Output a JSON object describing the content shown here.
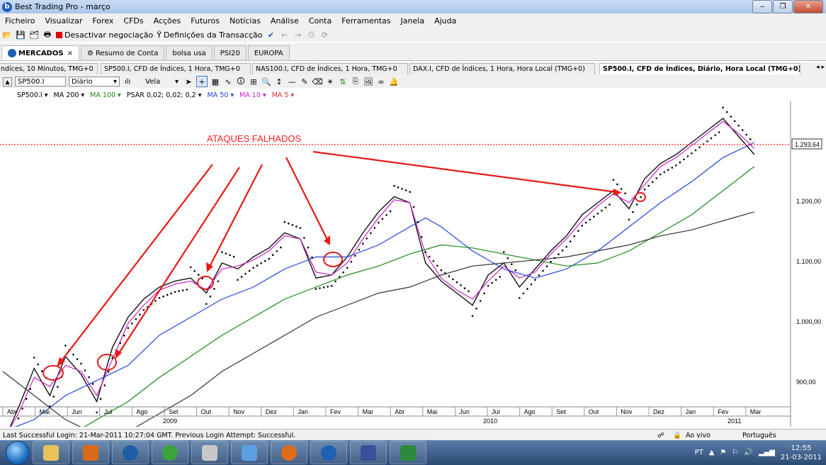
{
  "window": {
    "title": "Best Trading Pro - março",
    "minimize": "‒",
    "maximize": "❐",
    "close": "✕"
  },
  "menu": [
    "Ficheiro",
    "Visualizar",
    "Forex",
    "CFDs",
    "Acções",
    "Futuros",
    "Notícias",
    "Análise",
    "Conta",
    "Ferramentas",
    "Janela",
    "Ajuda"
  ],
  "toolbar": {
    "deactivate": "Desactivar negociação",
    "settings": "Definições da Transacção"
  },
  "workspace_tabs": [
    "MERCADOS",
    "Resumo de Conta",
    "bolsa usa",
    "PSI20",
    "EUROPA"
  ],
  "workspace_close": "×",
  "chart_tabs": [
    "ndices, 10 Minutos, TMG+0",
    "SP500.I, CFD de Índices, 1 Hora, TMG+0",
    "NAS100.I, CFD de Índices, 1 Hora, TMG+0",
    "DAX.I, CFD de Índices, 1 Hora, Hora Local (TMG+0)",
    "SP500.I, CFD de Índices, Diário, Hora Local (TMG+0)"
  ],
  "chart_toolbar": {
    "symbol": "SP500.I",
    "timeframe": "Diário",
    "chart_type": "Vela"
  },
  "indicators": [
    {
      "label": "SP500.I ▾",
      "color": "#000000"
    },
    {
      "label": "MA 200 ▾",
      "color": "#000000"
    },
    {
      "label": "MA 100 ▾",
      "color": "#178a17"
    },
    {
      "label": "PSAR 0,02; 0,02; 0,2 ▾",
      "color": "#000000"
    },
    {
      "label": "MA 50 ▾",
      "color": "#2244dd"
    },
    {
      "label": "MA 10 ▾",
      "color": "#cc22cc"
    },
    {
      "label": "MA 5 ▾",
      "color": "#dd3333"
    }
  ],
  "annotation": "ATAQUES FALHADOS",
  "price_labels": [
    "1.200,00",
    "1.100,00",
    "1.000,00",
    "900,00"
  ],
  "current_price": "1.293,64",
  "months": [
    "Abr",
    "Mai",
    "Jun",
    "Jul",
    "Ago",
    "Set",
    "Out",
    "Nov",
    "Dez",
    "Jan",
    "Fev",
    "Mar",
    "Abr",
    "Mai",
    "Jun",
    "Jul",
    "Ago",
    "Set",
    "Out",
    "Nov",
    "Dez",
    "Jan",
    "Fev",
    "Mar"
  ],
  "years": [
    "2009",
    "2010",
    "2011"
  ],
  "status": {
    "login": "Last Successful Login: 21-Mar-2011 10:27:04 GMT. Previous Login Attempt: Successful.",
    "live": "Ao vivo",
    "language": "Português"
  },
  "taskbar": {
    "lang": "PT",
    "time": "12:55",
    "date": "21-03-2011"
  },
  "chart_data": {
    "type": "line",
    "y_axis_ticks": [
      900,
      1000,
      1100,
      1200
    ],
    "current_price_level": 1293.64,
    "resistance_level": 1293.64,
    "series": [
      {
        "name": "SP500.I",
        "color": "#111111",
        "points": [
          [
            0,
            800
          ],
          [
            1,
            860
          ],
          [
            2,
            925
          ],
          [
            3,
            880
          ],
          [
            4,
            945
          ],
          [
            5,
            915
          ],
          [
            6,
            870
          ],
          [
            7,
            960
          ],
          [
            8,
            1010
          ],
          [
            9,
            1040
          ],
          [
            10,
            1060
          ],
          [
            11,
            1070
          ],
          [
            12,
            1075
          ],
          [
            13,
            1050
          ],
          [
            14,
            1100
          ],
          [
            15,
            1090
          ],
          [
            16,
            1110
          ],
          [
            17,
            1125
          ],
          [
            18,
            1150
          ],
          [
            19,
            1140
          ],
          [
            20,
            1075
          ],
          [
            21,
            1080
          ],
          [
            22,
            1110
          ],
          [
            23,
            1150
          ],
          [
            24,
            1185
          ],
          [
            25,
            1210
          ],
          [
            26,
            1200
          ],
          [
            27,
            1100
          ],
          [
            28,
            1070
          ],
          [
            29,
            1050
          ],
          [
            30,
            1030
          ],
          [
            31,
            1080
          ],
          [
            32,
            1100
          ],
          [
            33,
            1060
          ],
          [
            34,
            1090
          ],
          [
            35,
            1120
          ],
          [
            36,
            1145
          ],
          [
            37,
            1180
          ],
          [
            38,
            1200
          ],
          [
            39,
            1220
          ],
          [
            40,
            1190
          ],
          [
            41,
            1240
          ],
          [
            42,
            1265
          ],
          [
            43,
            1280
          ],
          [
            44,
            1300
          ],
          [
            45,
            1320
          ],
          [
            46,
            1340
          ],
          [
            47,
            1310
          ],
          [
            48,
            1280
          ]
        ]
      },
      {
        "name": "MA 10",
        "color": "#cc22cc",
        "points": [
          [
            0,
            805
          ],
          [
            1,
            850
          ],
          [
            2,
            910
          ],
          [
            3,
            895
          ],
          [
            4,
            930
          ],
          [
            5,
            920
          ],
          [
            6,
            880
          ],
          [
            7,
            940
          ],
          [
            8,
            1000
          ],
          [
            9,
            1030
          ],
          [
            10,
            1055
          ],
          [
            11,
            1065
          ],
          [
            12,
            1070
          ],
          [
            13,
            1055
          ],
          [
            14,
            1090
          ],
          [
            15,
            1095
          ],
          [
            16,
            1105
          ],
          [
            17,
            1120
          ],
          [
            18,
            1145
          ],
          [
            19,
            1140
          ],
          [
            20,
            1085
          ],
          [
            21,
            1080
          ],
          [
            22,
            1100
          ],
          [
            23,
            1140
          ],
          [
            24,
            1175
          ],
          [
            25,
            1205
          ],
          [
            26,
            1200
          ],
          [
            27,
            1115
          ],
          [
            28,
            1075
          ],
          [
            29,
            1055
          ],
          [
            30,
            1040
          ],
          [
            31,
            1070
          ],
          [
            32,
            1095
          ],
          [
            33,
            1075
          ],
          [
            34,
            1085
          ],
          [
            35,
            1115
          ],
          [
            36,
            1140
          ],
          [
            37,
            1170
          ],
          [
            38,
            1195
          ],
          [
            39,
            1215
          ],
          [
            40,
            1200
          ],
          [
            41,
            1230
          ],
          [
            42,
            1260
          ],
          [
            43,
            1275
          ],
          [
            44,
            1295
          ],
          [
            45,
            1315
          ],
          [
            46,
            1335
          ],
          [
            47,
            1315
          ],
          [
            48,
            1290
          ]
        ]
      },
      {
        "name": "MA 50",
        "color": "#2244dd",
        "points": [
          [
            0,
            820
          ],
          [
            2,
            840
          ],
          [
            4,
            880
          ],
          [
            6,
            905
          ],
          [
            8,
            930
          ],
          [
            10,
            980
          ],
          [
            12,
            1010
          ],
          [
            14,
            1040
          ],
          [
            16,
            1060
          ],
          [
            18,
            1090
          ],
          [
            20,
            1110
          ],
          [
            22,
            1110
          ],
          [
            24,
            1130
          ],
          [
            26,
            1160
          ],
          [
            27,
            1175
          ],
          [
            28,
            1160
          ],
          [
            30,
            1120
          ],
          [
            32,
            1090
          ],
          [
            34,
            1075
          ],
          [
            36,
            1090
          ],
          [
            38,
            1120
          ],
          [
            40,
            1160
          ],
          [
            42,
            1200
          ],
          [
            44,
            1235
          ],
          [
            46,
            1275
          ],
          [
            48,
            1300
          ]
        ]
      },
      {
        "name": "MA 100",
        "color": "#178a17",
        "points": [
          [
            4,
            810
          ],
          [
            6,
            840
          ],
          [
            8,
            870
          ],
          [
            10,
            910
          ],
          [
            12,
            945
          ],
          [
            14,
            980
          ],
          [
            16,
            1010
          ],
          [
            18,
            1040
          ],
          [
            20,
            1060
          ],
          [
            22,
            1080
          ],
          [
            24,
            1095
          ],
          [
            26,
            1115
          ],
          [
            28,
            1130
          ],
          [
            30,
            1125
          ],
          [
            32,
            1115
          ],
          [
            34,
            1105
          ],
          [
            36,
            1095
          ],
          [
            38,
            1100
          ],
          [
            40,
            1120
          ],
          [
            42,
            1150
          ],
          [
            44,
            1180
          ],
          [
            46,
            1220
          ],
          [
            48,
            1260
          ]
        ]
      },
      {
        "name": "MA 200",
        "color": "#333333",
        "points": [
          [
            0,
            920
          ],
          [
            2,
            880
          ],
          [
            4,
            840
          ],
          [
            6,
            815
          ],
          [
            8,
            820
          ],
          [
            10,
            850
          ],
          [
            12,
            880
          ],
          [
            14,
            920
          ],
          [
            16,
            950
          ],
          [
            18,
            980
          ],
          [
            20,
            1010
          ],
          [
            22,
            1030
          ],
          [
            24,
            1050
          ],
          [
            26,
            1060
          ],
          [
            28,
            1080
          ],
          [
            30,
            1095
          ],
          [
            32,
            1100
          ],
          [
            34,
            1105
          ],
          [
            36,
            1110
          ],
          [
            38,
            1120
          ],
          [
            40,
            1130
          ],
          [
            42,
            1145
          ],
          [
            44,
            1155
          ],
          [
            46,
            1170
          ],
          [
            48,
            1185
          ]
        ]
      }
    ]
  }
}
